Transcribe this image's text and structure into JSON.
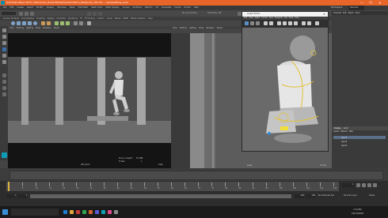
{
  "window": {
    "title": "Autodesk Maya 2019: \\Users\\ucla_student\\Desktop\\animation_files\\pose_v01.mb  ---  persp/sitting_pose",
    "controls": [
      "—",
      "❐",
      "✕"
    ]
  },
  "menus": [
    "File",
    "Edit",
    "Create",
    "Select",
    "Modify",
    "Display",
    "Windows",
    "Mesh",
    "Edit Mesh",
    "Mesh Tools",
    "Mesh Display",
    "Curves",
    "Surfaces",
    "Deform",
    "UV",
    "Generate",
    "Cache",
    "Arnold",
    "Help"
  ],
  "workspace": {
    "label": "Workspace:",
    "value": "General"
  },
  "status": {
    "no_live": "No Live Surface",
    "symmetry": "Symmetry: Off",
    "signin": "Sign In"
  },
  "shelf_tabs": [
    "Curves / Surfaces",
    "Poly Modeling",
    "Sculpting",
    "Rigging",
    "Animation",
    "Rendering",
    "FX",
    "FX Caching",
    "Custom",
    "Arnold",
    "Bifrost",
    "MASH",
    "Motion Graphics",
    "XGen"
  ],
  "viewports": {
    "left": {
      "menu": [
        "View",
        "Shading",
        "Lighting",
        "Show",
        "Renderer",
        "Panels"
      ],
      "camera": "left_cam1",
      "focal_label": "Focal Length:",
      "focal_value": "35.000",
      "frame_label": "Frame:",
      "frame_value": "1",
      "fps": "0 fps"
    },
    "center": {
      "menu": [
        "View",
        "Shading",
        "Lighting",
        "Show",
        "Renderer",
        "Panels"
      ],
      "camera": "persp",
      "fps": "5.4 fps"
    }
  },
  "graph_editor": {
    "title": "Graph Editor",
    "menu": [
      "Edit",
      "View",
      "Select",
      "Curves",
      "Keys",
      "Tangents",
      "List",
      "Show",
      "Help"
    ]
  },
  "outliner": {
    "tabs": [
      "Display",
      "Anim"
    ],
    "menu": [
      "Layers",
      "Options",
      "Help"
    ],
    "layers": [
      "layer1",
      "layer2",
      "layer3"
    ]
  },
  "channel_box": {
    "tabs": [
      "Channels",
      "Edit",
      "Object",
      "Show"
    ]
  },
  "timeline": {
    "start": "1",
    "end": "120",
    "current": "1",
    "ticks": [
      "1",
      "5",
      "10",
      "15",
      "20",
      "25",
      "30",
      "35",
      "40",
      "45",
      "50",
      "55",
      "60",
      "65",
      "70",
      "75",
      "80",
      "85",
      "90",
      "95",
      "100",
      "105",
      "110",
      "115",
      "120"
    ],
    "range_start": "1",
    "range_end": "120",
    "char_set": "No Character Set",
    "anim_layer": "No Anim Layer",
    "fps": "24 fps"
  },
  "taskbar": {
    "time": "7:14 PM",
    "date": "10/13/2019"
  }
}
